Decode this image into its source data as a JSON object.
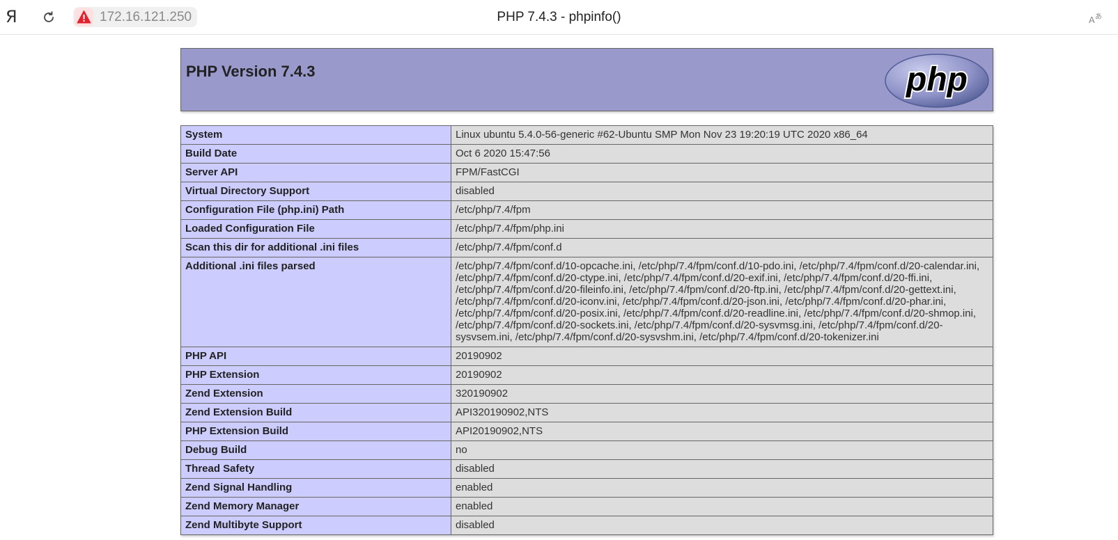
{
  "browser": {
    "brand_glyph": "Я",
    "reload_icon": "reload-icon",
    "security_icon": "warning-icon",
    "address": "172.16.121.250",
    "tab_title": "PHP 7.4.3 - phpinfo()",
    "translate_icon": "translate-icon"
  },
  "page": {
    "heading": "PHP Version 7.4.3",
    "logo_text": "php",
    "colors": {
      "header_bg": "#9999cc",
      "key_bg": "#ccccff",
      "value_bg": "#dddddd",
      "border": "#666666"
    },
    "rows": [
      {
        "key": "System",
        "value": "Linux ubuntu 5.4.0-56-generic #62-Ubuntu SMP Mon Nov 23 19:20:19 UTC 2020 x86_64"
      },
      {
        "key": "Build Date",
        "value": "Oct 6 2020 15:47:56"
      },
      {
        "key": "Server API",
        "value": "FPM/FastCGI"
      },
      {
        "key": "Virtual Directory Support",
        "value": "disabled"
      },
      {
        "key": "Configuration File (php.ini) Path",
        "value": "/etc/php/7.4/fpm"
      },
      {
        "key": "Loaded Configuration File",
        "value": "/etc/php/7.4/fpm/php.ini"
      },
      {
        "key": "Scan this dir for additional .ini files",
        "value": "/etc/php/7.4/fpm/conf.d"
      },
      {
        "key": "Additional .ini files parsed",
        "value": "/etc/php/7.4/fpm/conf.d/10-opcache.ini, /etc/php/7.4/fpm/conf.d/10-pdo.ini, /etc/php/7.4/fpm/conf.d/20-calendar.ini, /etc/php/7.4/fpm/conf.d/20-ctype.ini, /etc/php/7.4/fpm/conf.d/20-exif.ini, /etc/php/7.4/fpm/conf.d/20-ffi.ini, /etc/php/7.4/fpm/conf.d/20-fileinfo.ini, /etc/php/7.4/fpm/conf.d/20-ftp.ini, /etc/php/7.4/fpm/conf.d/20-gettext.ini, /etc/php/7.4/fpm/conf.d/20-iconv.ini, /etc/php/7.4/fpm/conf.d/20-json.ini, /etc/php/7.4/fpm/conf.d/20-phar.ini, /etc/php/7.4/fpm/conf.d/20-posix.ini, /etc/php/7.4/fpm/conf.d/20-readline.ini, /etc/php/7.4/fpm/conf.d/20-shmop.ini, /etc/php/7.4/fpm/conf.d/20-sockets.ini, /etc/php/7.4/fpm/conf.d/20-sysvmsg.ini, /etc/php/7.4/fpm/conf.d/20-sysvsem.ini, /etc/php/7.4/fpm/conf.d/20-sysvshm.ini, /etc/php/7.4/fpm/conf.d/20-tokenizer.ini"
      },
      {
        "key": "PHP API",
        "value": "20190902"
      },
      {
        "key": "PHP Extension",
        "value": "20190902"
      },
      {
        "key": "Zend Extension",
        "value": "320190902"
      },
      {
        "key": "Zend Extension Build",
        "value": "API320190902,NTS"
      },
      {
        "key": "PHP Extension Build",
        "value": "API20190902,NTS"
      },
      {
        "key": "Debug Build",
        "value": "no"
      },
      {
        "key": "Thread Safety",
        "value": "disabled"
      },
      {
        "key": "Zend Signal Handling",
        "value": "enabled"
      },
      {
        "key": "Zend Memory Manager",
        "value": "enabled"
      },
      {
        "key": "Zend Multibyte Support",
        "value": "disabled"
      }
    ]
  }
}
